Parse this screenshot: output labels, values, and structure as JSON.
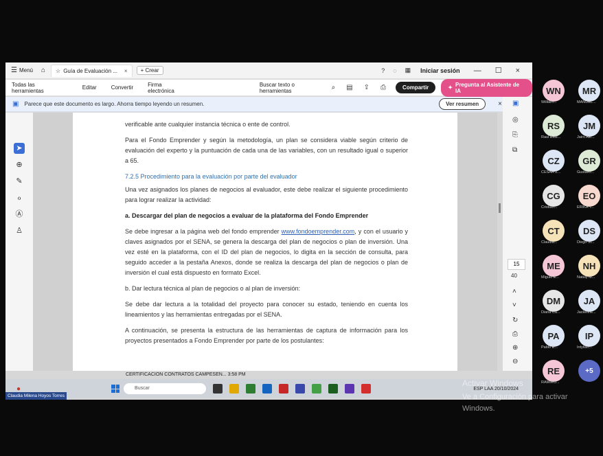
{
  "titlebar": {
    "menu": "Menú",
    "tab_title": "Guía de Evaluación ...",
    "new_tab": "+ Crear",
    "sign_in": "Iniciar sesión"
  },
  "toolbar": {
    "all_tools": "Todas las herramientas",
    "edit": "Editar",
    "convert": "Convertir",
    "esign": "Firma electrónica",
    "search": "Buscar texto o herramientas",
    "share": "Compartir",
    "ai_assistant": "Pregunta al Asistente de IA"
  },
  "banner": {
    "message": "Parece que este documento es largo. Ahorra tiempo leyendo un resumen.",
    "summary_button": "Ver resumen"
  },
  "document": {
    "p0": "verificable ante cualquier instancia técnica o ente de control.",
    "p1": "Para el Fondo Emprender y según la metodología, un plan se considera viable según criterio de evaluación del experto y la puntuación de cada una de las variables, con un resultado igual o superior a 65.",
    "heading": "7.2.5 Procedimiento para la evaluación por parte del evaluador",
    "p2": "Una vez asignados los planes de negocios al evaluador, este debe realizar el siguiente procedimiento para lograr realizar la actividad:",
    "sub_a": "a.   Descargar del plan de negocios a evaluar de la plataforma del Fondo Emprender",
    "p3_pre": "Se debe ingresar a la página web del fondo emprender ",
    "p3_link": "www.fondoemprender.com",
    "p3_post": ", y con el usuario y claves asignados por el SENA, se genera la descarga del plan de negocios o plan de inversión. Una vez esté en la plataforma, con el ID del plan de negocios, lo digita en la sección de consulta, para seguido acceder a la pestaña Anexos, donde se realiza la descarga del plan de negocios o plan de inversión el cual está dispuesto en formato Excel.",
    "sub_b": "b.   Dar lectura técnica al plan de negocios o al plan de inversión:",
    "p4": "Se debe dar lectura a la totalidad del proyecto para conocer su estado, teniendo en cuenta los lineamientos y las herramientas entregadas por el SENA.",
    "p5": "A continuación, se presenta la estructura de las herramientas de captura de información para los proyectos presentados a Fondo Emprender por parte de los postulantes:"
  },
  "page_nav": {
    "current": "15",
    "total": "40"
  },
  "taskbar": {
    "notification": "CERTIFICACION CONTRATOS CAMPESEN...    3:58 PM",
    "search": "Buscar",
    "tray": "ESP LAA   20/10/2024"
  },
  "presenter_name": "Claudia Milena Hoyos Torres",
  "participants": [
    {
      "initials": "WN",
      "name": "William...",
      "color": "#f4c6d6"
    },
    {
      "initials": "MR",
      "name": "MANUEL...",
      "color": "#dde6f5"
    },
    {
      "initials": "RS",
      "name": "Raul Este...",
      "color": "#dcead6"
    },
    {
      "initials": "JM",
      "name": "Jairo Ale...",
      "color": "#dde6f5"
    },
    {
      "initials": "CZ",
      "name": "CESAR Z...",
      "color": "#dde6f5"
    },
    {
      "initials": "GR",
      "name": "Gustavo...",
      "color": "#dcead6"
    },
    {
      "initials": "CG",
      "name": "Cristian...",
      "color": "#e6e6e6"
    },
    {
      "initials": "EO",
      "name": "ERIKA T...",
      "color": "#f8d9cf"
    },
    {
      "initials": "CT",
      "name": "Claudia...",
      "color": "#f6e2b8"
    },
    {
      "initials": "DS",
      "name": "Diego Si...",
      "color": "#dde6f5"
    },
    {
      "initials": "ME",
      "name": "Miguel E...",
      "color": "#f4c6d6"
    },
    {
      "initials": "NH",
      "name": "Nataly M...",
      "color": "#f6e2b8"
    },
    {
      "initials": "DM",
      "name": "Diana Ca...",
      "color": "#e6e6e6"
    },
    {
      "initials": "JA",
      "name": "Jackeline...",
      "color": "#dde6f5"
    },
    {
      "initials": "PA",
      "name": "Pablo E...",
      "color": "#dde6f5"
    },
    {
      "initials": "IP",
      "name": "Intyilan...",
      "color": "#dde6f5"
    },
    {
      "initials": "RE",
      "name": "RAMIRO...",
      "color": "#f4c6d6"
    },
    {
      "initials": "+5",
      "name": "",
      "color": "#5b6ac4"
    }
  ],
  "watermark": {
    "line1": "Activar Windows",
    "line2": "Ve a Configuración para activar Windows."
  }
}
